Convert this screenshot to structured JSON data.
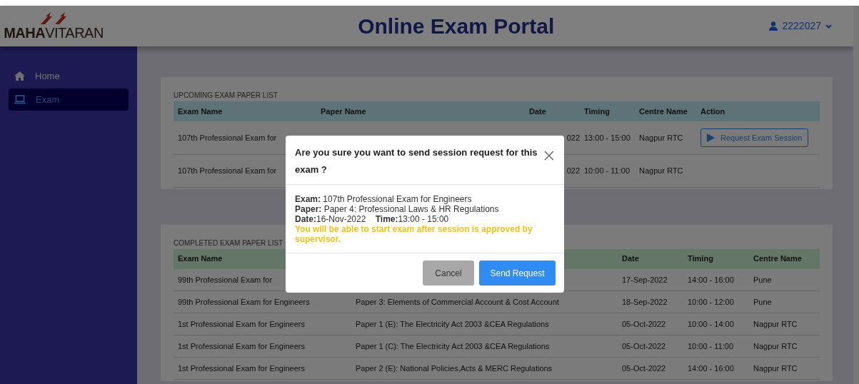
{
  "header": {
    "logo": {
      "bold": "MAHA",
      "light": "VITARAN"
    },
    "title": "Online Exam Portal",
    "user": "2222027"
  },
  "sidebar": {
    "items": [
      {
        "label": "Home",
        "kind": "home",
        "selected": false
      },
      {
        "label": "Exam",
        "kind": "laptop",
        "selected": true
      }
    ]
  },
  "upcoming": {
    "title": "UPCOMING EXAM PAPER LIST",
    "columns": [
      "Exam Name",
      "Paper Name",
      "Date",
      "Timing",
      "Centre Name",
      "Action"
    ],
    "rows": [
      {
        "exam_name": "107th Professional Exam for",
        "date": "022",
        "timing": "13:00 - 15:00",
        "centre": "Nagpur RTC",
        "action": "Request Exam Session"
      },
      {
        "exam_name": "107th Professional Exam for",
        "date": "022",
        "timing": "10:00 - 11:00",
        "centre": "Nagpur RTC"
      }
    ]
  },
  "completed": {
    "title": "COMPLETED EXAM PAPER LIST",
    "columns": [
      "Exam Name",
      "Date",
      "Timing",
      "Centre Name"
    ],
    "rows": [
      {
        "exam_name": "99th Professional Exam for",
        "date": "17-Sep-2022",
        "timing": "14:00 - 16:00",
        "centre": "Pune"
      },
      {
        "exam_name": "99th Professional Exam for Engineers",
        "paper_name": "Paper 3: Elements of Commercial Account & Cost Account",
        "date": "18-Sep-2022",
        "timing": "10:00 - 12:00",
        "centre": "Pune"
      },
      {
        "exam_name": "1st Professional Exam for Engineers",
        "paper_name": "Paper 1 (E): The Electricity Act 2003 &CEA Regulations",
        "date": "05-Oct-2022",
        "timing": "10:00 - 14:00",
        "centre": "Nagpur RTC"
      },
      {
        "exam_name": "1st Professional Exam for Engineers",
        "paper_name": "Paper 1 (C): The Electricity Act 2003 &CEA Regulations",
        "date": "05-Oct-2022",
        "timing": "10:00 - 11:00",
        "centre": "Nagpur RTC"
      },
      {
        "exam_name": "1st Professional Exam for Engineers",
        "paper_name": "Paper 2 (E): National Policies,Acts & MERC Regulations",
        "date": "05-Oct-2022",
        "timing": "14:00 - 16:00",
        "centre": "Nagpur RTC"
      }
    ]
  },
  "modal": {
    "title": "Are you sure you want to send session request for this exam ?",
    "lines": [
      "**Exam:** 107th Professional Exam for Engineers",
      "**Paper:** Paper 4: Professional Laws & HR Regulations",
      "**Date:**16-Nov-2022    **Time:**13:00 - 15:00"
    ],
    "note": "You will be able to start exam after session is approved by supervisor.",
    "buttons": [
      {
        "label": "Cancel",
        "kind": "secondary"
      },
      {
        "label": "Send Request",
        "kind": "primary"
      }
    ]
  }
}
